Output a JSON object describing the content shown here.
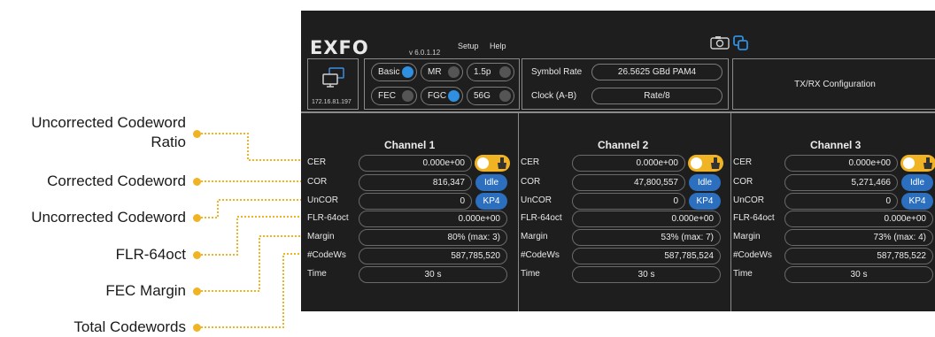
{
  "annotations": {
    "uncorrected_codeword_ratio_line1": "Uncorrected Codeword",
    "uncorrected_codeword_ratio_line2": "Ratio",
    "corrected_codeword": "Corrected Codeword",
    "uncorrected_codeword": "Uncorrected Codeword",
    "flr": "FLR-64oct",
    "fec_margin": "FEC Margin",
    "total_codewords": "Total Codewords"
  },
  "app": {
    "logo": "EXFO",
    "version": "v 6.0.1.12",
    "menu": {
      "setup": "Setup",
      "help": "Help"
    },
    "toolbar_icons": [
      "camera-icon",
      "copy-icon"
    ],
    "device": {
      "ip": "172.16.81.197",
      "icon": "network-computers-icon"
    },
    "modes": [
      {
        "label": "Basic",
        "on": true
      },
      {
        "label": "MR",
        "on": false
      },
      {
        "label": "1.5p",
        "on": false
      },
      {
        "label": "FEC",
        "on": false
      },
      {
        "label": "FGC",
        "on": true
      },
      {
        "label": "56G",
        "on": false
      }
    ],
    "symbol_rate": {
      "label": "Symbol Rate",
      "value": "26.5625 GBd PAM4"
    },
    "clock": {
      "label": "Clock (A-B)",
      "value": "Rate/8"
    },
    "txrx_button": "TX/RX Configuration",
    "row_labels": [
      "CER",
      "COR",
      "UnCOR",
      "FLR-64oct",
      "Margin",
      "#CodeWs",
      "Time"
    ],
    "channels": [
      {
        "title": "Channel 1",
        "cer": "0.000e+00",
        "cor": "816,347",
        "cor_status": "Idle",
        "uncor": "0",
        "uncor_type": "KP4",
        "flr": "0.000e+00",
        "margin": "80% (max: 3)",
        "codews": "587,785,520",
        "time": "30 s"
      },
      {
        "title": "Channel 2",
        "cer": "0.000e+00",
        "cor": "47,800,557",
        "cor_status": "Idle",
        "uncor": "0",
        "uncor_type": "KP4",
        "flr": "0.000e+00",
        "margin": "53% (max: 7)",
        "codews": "587,785,524",
        "time": "30 s"
      },
      {
        "title": "Channel 3",
        "cer": "0.000e+00",
        "cor": "5,271,466",
        "cor_status": "Idle",
        "uncor": "0",
        "uncor_type": "KP4",
        "flr": "0.000e+00",
        "margin": "73% (max: 4)",
        "codews": "587,785,522",
        "time": "30 s"
      }
    ]
  },
  "colors": {
    "accent_yellow": "#f0b323",
    "badge_blue": "#2c6fbf",
    "panel_bg": "#1e1e1e",
    "indicator_blue": "#2f8fe0"
  }
}
